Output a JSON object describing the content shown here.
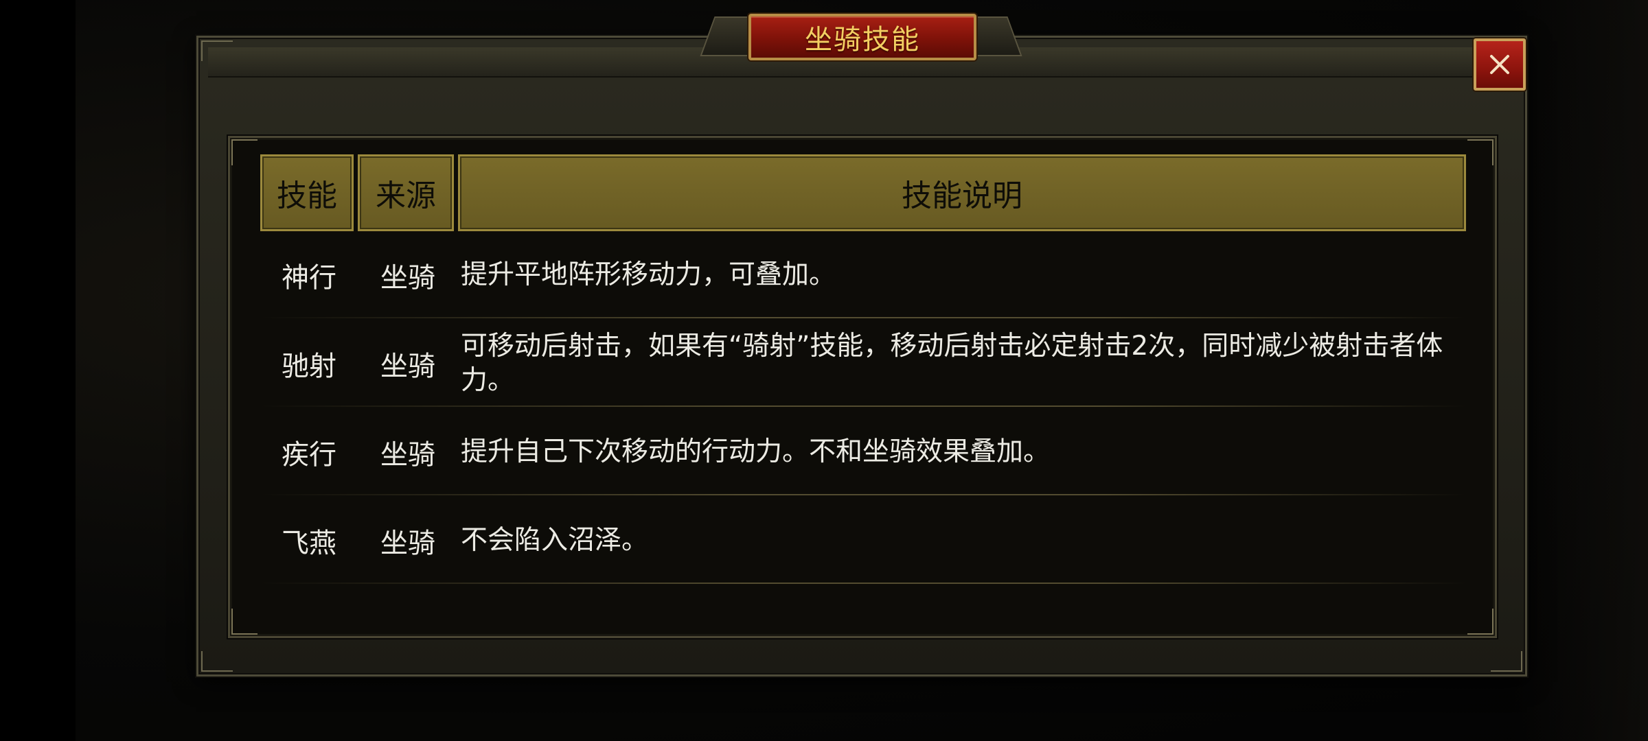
{
  "dialog": {
    "title": "坐骑技能",
    "close_label": "✕"
  },
  "table": {
    "headers": [
      "技能",
      "来源",
      "技能说明"
    ],
    "rows": [
      {
        "skill": "神行",
        "source": "坐骑",
        "desc": "提升平地阵形移动力，可叠加。"
      },
      {
        "skill": "驰射",
        "source": "坐骑",
        "desc": "可移动后射击，如果有“骑射”技能，移动后射击必定射击2次，同时减少被射击者体力。"
      },
      {
        "skill": "疾行",
        "source": "坐骑",
        "desc": "提升自己下次移动的行动力。不和坐骑效果叠加。"
      },
      {
        "skill": "飞燕",
        "source": "坐骑",
        "desc": "不会陷入沼泽。"
      }
    ]
  },
  "icons": {
    "close": "close-icon"
  },
  "colors": {
    "title_text": "#f3cf62",
    "title_plate": "#8a150b",
    "header_fill": "#6f6127",
    "body_text": "#ecebe4",
    "close_button": "#a01c14"
  }
}
